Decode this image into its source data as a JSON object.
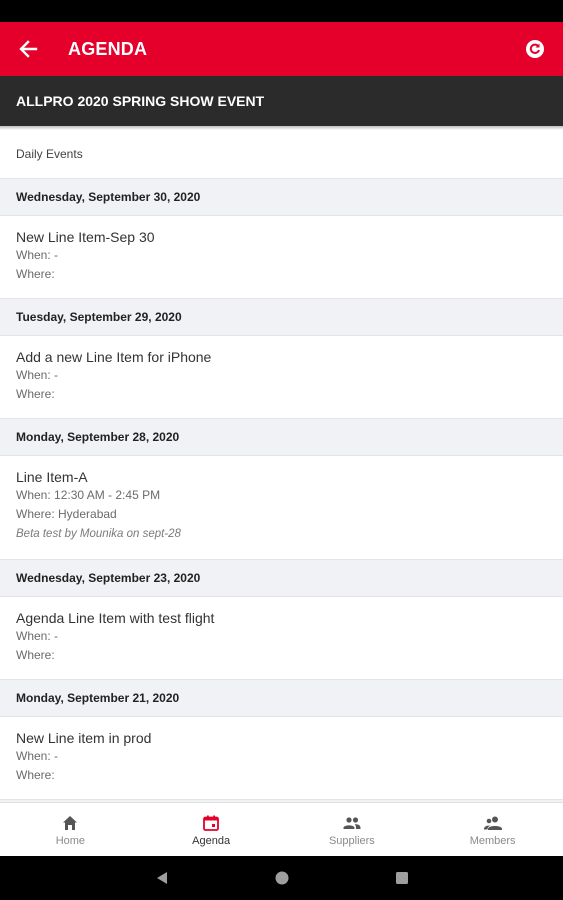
{
  "app_bar": {
    "title": "AGENDA",
    "color": "#e4002b",
    "back_icon": "arrow-left-icon",
    "action_icon": "sync-icon"
  },
  "event": {
    "title": "ALLPRO 2020 SPRING SHOW EVENT"
  },
  "section_label": "Daily Events",
  "days": [
    {
      "date": "Wednesday, September 30, 2020",
      "items": [
        {
          "name": "New Line Item-Sep 30",
          "when": "When: -",
          "where": "Where:",
          "note": ""
        }
      ]
    },
    {
      "date": "Tuesday, September 29, 2020",
      "items": [
        {
          "name": "Add a new Line Item for iPhone",
          "when": "When: -",
          "where": "Where:",
          "note": ""
        }
      ]
    },
    {
      "date": "Monday, September 28, 2020",
      "items": [
        {
          "name": "Line Item-A",
          "when": "When: 12:30 AM - 2:45 PM",
          "where": "Where: Hyderabad",
          "note": "Beta test by Mounika on sept-28"
        }
      ]
    },
    {
      "date": "Wednesday, September 23, 2020",
      "items": [
        {
          "name": "Agenda Line Item with test flight",
          "when": "When: -",
          "where": "Where:",
          "note": ""
        }
      ]
    },
    {
      "date": "Monday, September 21, 2020",
      "items": [
        {
          "name": "New Line item in prod",
          "when": "When: -",
          "where": "Where:",
          "note": ""
        }
      ]
    }
  ],
  "bottom_nav": {
    "items": [
      {
        "label": "Home",
        "icon": "home-icon",
        "active": false
      },
      {
        "label": "Agenda",
        "icon": "calendar-icon",
        "active": true
      },
      {
        "label": "Suppliers",
        "icon": "people-icon",
        "active": false
      },
      {
        "label": "Members",
        "icon": "members-icon",
        "active": false
      }
    ],
    "active_color": "#e4002b",
    "inactive_color": "#8a8a8a"
  },
  "system_nav": {
    "buttons": [
      "back-triangle-icon",
      "home-circle-icon",
      "recents-square-icon"
    ]
  }
}
